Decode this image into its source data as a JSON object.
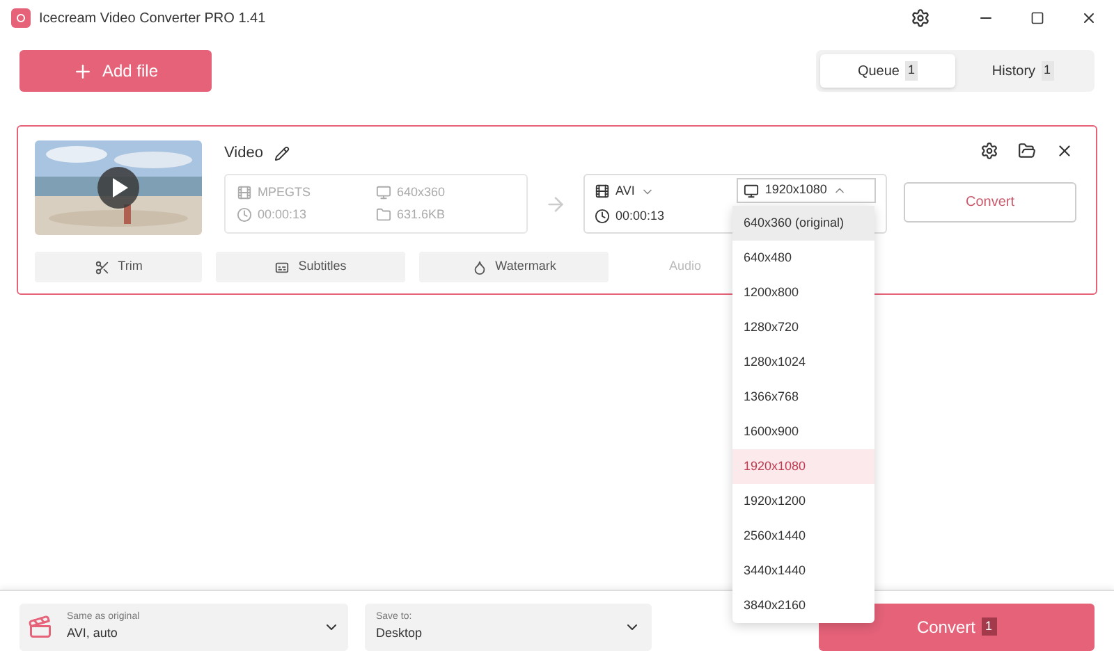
{
  "window": {
    "title": "Icecream Video Converter PRO 1.41"
  },
  "add_button": {
    "label": "Add file"
  },
  "tabs": [
    {
      "label": "Queue",
      "count": "1",
      "selected": true
    },
    {
      "label": "History",
      "count": "1",
      "selected": false
    }
  ],
  "file": {
    "name": "Video",
    "source": {
      "format": "MPEGTS",
      "resolution": "640x360",
      "duration": "00:00:13",
      "size": "631.6KB"
    },
    "output": {
      "format": "AVI",
      "duration": "00:00:13",
      "resolution": "1920x1080"
    },
    "convert_label": "Convert",
    "tools": [
      {
        "label": "Trim",
        "disabled": false
      },
      {
        "label": "Subtitles",
        "disabled": false
      },
      {
        "label": "Watermark",
        "disabled": false
      },
      {
        "label": "Audio",
        "disabled": true
      }
    ]
  },
  "resolution_menu": [
    {
      "label": "640x360 (original)",
      "selected": false,
      "hovered": true
    },
    {
      "label": "640x480",
      "selected": false,
      "hovered": false
    },
    {
      "label": "1200x800",
      "selected": false,
      "hovered": false
    },
    {
      "label": "1280x720",
      "selected": false,
      "hovered": false
    },
    {
      "label": "1280x1024",
      "selected": false,
      "hovered": false
    },
    {
      "label": "1366x768",
      "selected": false,
      "hovered": false
    },
    {
      "label": "1600x900",
      "selected": false,
      "hovered": false
    },
    {
      "label": "1920x1080",
      "selected": true,
      "hovered": false
    },
    {
      "label": "1920x1200",
      "selected": false,
      "hovered": false
    },
    {
      "label": "2560x1440",
      "selected": false,
      "hovered": false
    },
    {
      "label": "3440x1440",
      "selected": false,
      "hovered": false
    },
    {
      "label": "3840x2160",
      "selected": false,
      "hovered": false
    }
  ],
  "bottom": {
    "preset_caption": "Same as original",
    "preset_value": "AVI, auto",
    "save_caption": "Save to:",
    "save_value": "Desktop",
    "convert_label": "Convert",
    "convert_count": "1"
  }
}
